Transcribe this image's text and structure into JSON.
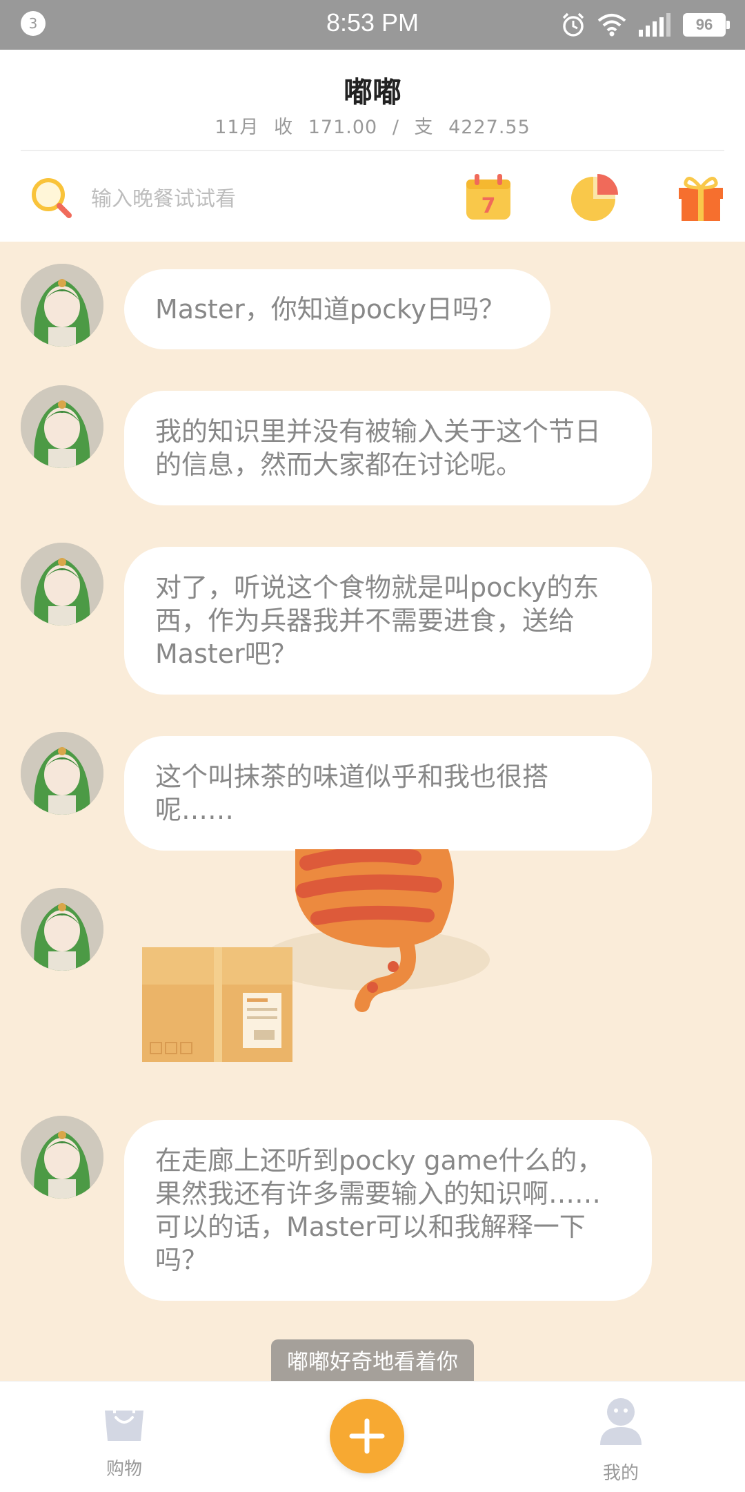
{
  "status_bar": {
    "notification_count": "3",
    "time": "8:53 PM",
    "battery": "96"
  },
  "header": {
    "title": "嘟嘟",
    "month": "11月",
    "income_label": "收",
    "income": "171.00",
    "separator": "/",
    "expense_label": "支",
    "expense": "4227.55"
  },
  "search": {
    "placeholder": "输入晚餐试试看",
    "value": ""
  },
  "toolbar_icons": [
    "calendar-icon",
    "pie-chart-icon",
    "gift-icon"
  ],
  "calendar_icon_text": "7",
  "messages": [
    {
      "text": "Master，你知道pocky日吗？"
    },
    {
      "text": "我的知识里并没有被输入关于这个节日的信息，然而大家都在讨论呢。"
    },
    {
      "text": "对了，听说这个食物就是叫pocky的东西，作为兵器我并不需要进食，送给Master吧？"
    },
    {
      "text": "这个叫抹茶的味道似乎和我也很搭呢……"
    },
    {
      "text": "在走廊上还听到pocky game什么的，果然我还有许多需要输入的知识啊……可以的话，Master可以和我解释一下吗？"
    }
  ],
  "toast": "嘟嘟好奇地看着你",
  "bottom_nav": {
    "shop_label": "购物",
    "add_icon": "plus-icon",
    "me_label": "我的"
  },
  "colors": {
    "chat_background": "#faecd9",
    "accent": "#f7a932",
    "status_bar": "#999999"
  }
}
